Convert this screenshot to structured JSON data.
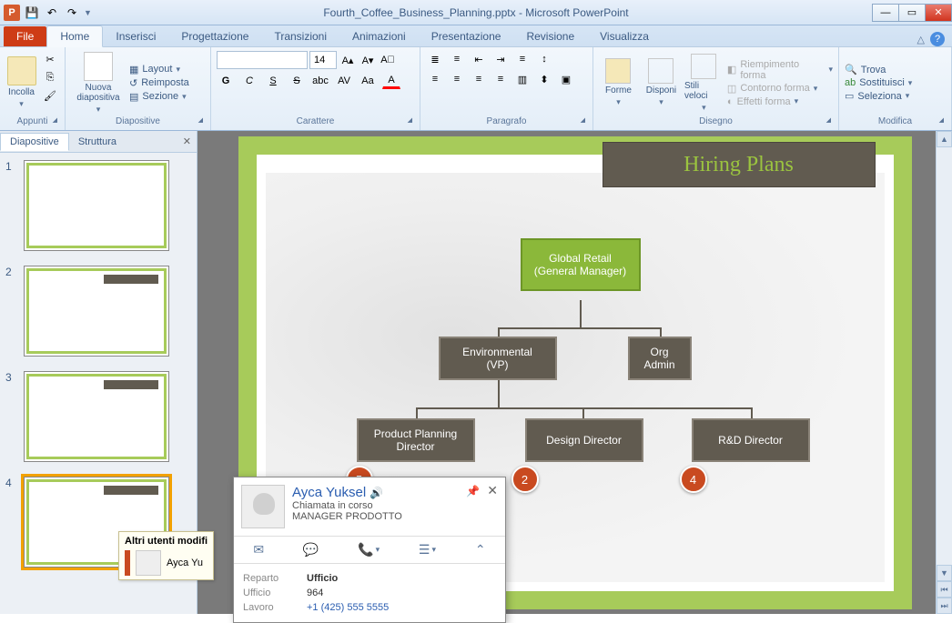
{
  "app": {
    "title": "Fourth_Coffee_Business_Planning.pptx - Microsoft PowerPoint"
  },
  "tabs": {
    "file": "File",
    "items": [
      "Home",
      "Inserisci",
      "Progettazione",
      "Transizioni",
      "Animazioni",
      "Presentazione",
      "Revisione",
      "Visualizza"
    ],
    "active": 0
  },
  "ribbon": {
    "clipboard": {
      "label": "Appunti",
      "paste": "Incolla"
    },
    "slides": {
      "label": "Diapositive",
      "new_slide": "Nuova diapositiva",
      "layout": "Layout",
      "reset": "Reimposta",
      "section": "Sezione"
    },
    "font": {
      "label": "Carattere",
      "size": "14",
      "bold": "G",
      "italic": "C",
      "underline": "S",
      "strike": "S",
      "shadow": "abc",
      "spacing": "AV",
      "case": "Aa",
      "color": "A"
    },
    "paragraph": {
      "label": "Paragrafo"
    },
    "drawing": {
      "label": "Disegno",
      "shapes": "Forme",
      "arrange": "Disponi",
      "styles": "Stili veloci",
      "fill": "Riempimento forma",
      "outline": "Contorno forma",
      "effects": "Effetti forma"
    },
    "editing": {
      "label": "Modifica",
      "find": "Trova",
      "replace": "Sostituisci",
      "select": "Seleziona"
    }
  },
  "panel": {
    "tabs": {
      "slides": "Diapositive",
      "outline": "Struttura"
    },
    "thumbs": [
      {
        "num": "1"
      },
      {
        "num": "2"
      },
      {
        "num": "3"
      },
      {
        "num": "4"
      }
    ]
  },
  "slide": {
    "title": "Hiring Plans",
    "nodes": {
      "top": {
        "line1": "Global Retail",
        "line2": "(General Manager)"
      },
      "env": {
        "line1": "Environmental",
        "line2": "(VP)"
      },
      "org": {
        "line1": "Org",
        "line2": "Admin"
      },
      "prod": {
        "line1": "Product Planning",
        "line2": "Director"
      },
      "design": {
        "line1": "Design Director"
      },
      "rnd": {
        "line1": "R&D Director"
      }
    },
    "badges": {
      "b1": "5",
      "b2": "2",
      "b3": "4"
    }
  },
  "contact": {
    "name": "Ayca Yuksel",
    "status": "Chiamata in corso",
    "title": "MANAGER PRODOTTO",
    "dept_label": "Reparto",
    "dept_value": "Ufficio",
    "office_label": "Ufficio",
    "office_value": "964",
    "work_label": "Lavoro",
    "work_value": "+1 (425) 555 5555"
  },
  "other_users": {
    "title": "Altri utenti modifi",
    "user": "Ayca Yu"
  }
}
